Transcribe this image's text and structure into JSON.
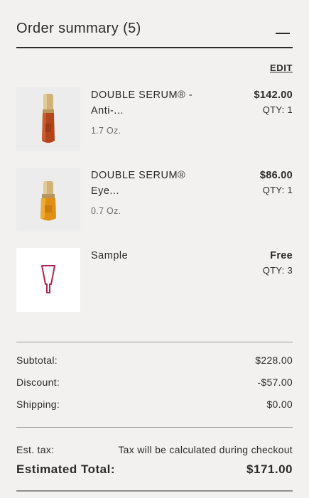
{
  "summary": {
    "title": "Order summary (5)",
    "edit_label": "EDIT"
  },
  "items": [
    {
      "name": "DOUBLE SERUM® - Anti-...",
      "size": "1.7 Oz.",
      "price": "$142.00",
      "qty": "QTY: 1",
      "image_icon": "serum-bottle-icon"
    },
    {
      "name": "DOUBLE SERUM® Eye...",
      "size": "0.7 Oz.",
      "price": "$86.00",
      "qty": "QTY: 1",
      "image_icon": "eye-serum-bottle-icon"
    },
    {
      "name": "Sample",
      "size": "",
      "price": "Free",
      "qty": "QTY: 3",
      "image_icon": "sample-tube-icon"
    }
  ],
  "totals": {
    "subtotal_label": "Subtotal:",
    "subtotal_value": "$228.00",
    "discount_label": "Discount:",
    "discount_value": "-$57.00",
    "shipping_label": "Shipping:",
    "shipping_value": "$0.00",
    "tax_label": "Est. tax:",
    "tax_value": "Tax will be calculated during checkout",
    "total_label": "Estimated Total:",
    "total_value": "$171.00"
  },
  "colors": {
    "background": "#f2f1ef",
    "text": "#2b2b2b",
    "sample_icon": "#b0264a",
    "serum_gold": "#c9a66a",
    "serum_amber": "#b4441c"
  }
}
